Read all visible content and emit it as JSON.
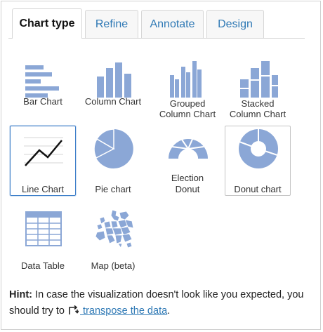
{
  "tabs": [
    {
      "label": "Chart type",
      "active": true
    },
    {
      "label": "Refine",
      "active": false
    },
    {
      "label": "Annotate",
      "active": false
    },
    {
      "label": "Design",
      "active": false
    }
  ],
  "chart_types": [
    {
      "label": "Bar Chart",
      "icon": "bar-chart-icon"
    },
    {
      "label": "Column Chart",
      "icon": "column-chart-icon"
    },
    {
      "label": "Grouped\nColumn Chart",
      "icon": "grouped-column-chart-icon"
    },
    {
      "label": "Stacked\nColumn Chart",
      "icon": "stacked-column-chart-icon"
    },
    {
      "label": "Line Chart",
      "icon": "line-chart-icon",
      "selected": true
    },
    {
      "label": "Pie chart",
      "icon": "pie-chart-icon"
    },
    {
      "label": "Election\nDonut",
      "icon": "election-donut-icon"
    },
    {
      "label": "Donut chart",
      "icon": "donut-chart-icon"
    },
    {
      "label": "Data Table",
      "icon": "data-table-icon"
    },
    {
      "label": "Map (beta)",
      "icon": "map-icon"
    }
  ],
  "hint": {
    "label": "Hint:",
    "text": " In case the visualization doesn't look like you expected, you should try to ",
    "link": " transpose the data",
    "end": "."
  },
  "colors": {
    "icon": "#8ba7d6",
    "link": "#2f79b5",
    "selected_border": "#3d7ec9"
  }
}
